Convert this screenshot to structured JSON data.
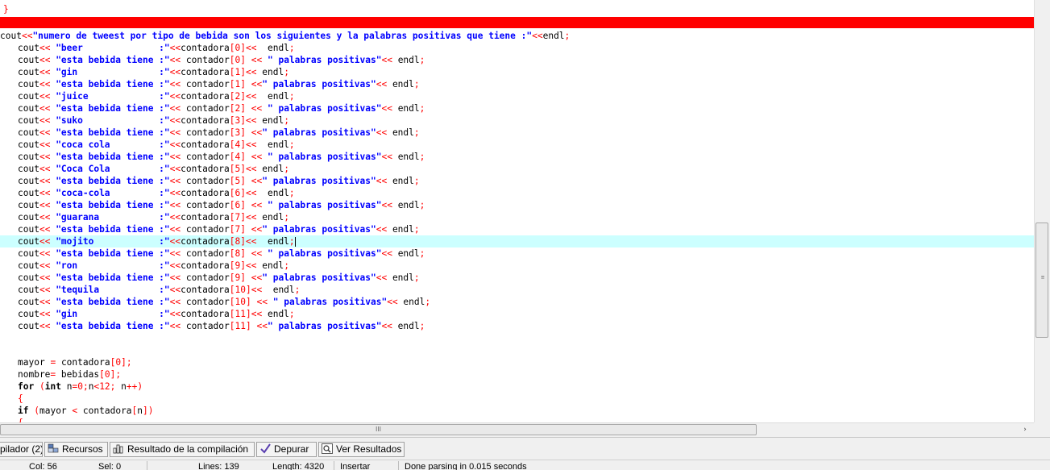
{
  "editor": {
    "code": {
      "l0": "}",
      "l2_1": "cout",
      "l2_2": "<<",
      "l2_3": "\"numero de tweest por tipo de bebida son los siguientes y la palabras positivas que tiene :\"",
      "l2_4": "<<",
      "l2_5": "endl",
      "l2_6": ";",
      "b_cout": "cout",
      "b_op": "<<",
      "b_endl": "endl",
      "b_semi": ";",
      "b_lb": "[",
      "b_rb": "]",
      "v_contadora": "contadora",
      "v_contador": "contador",
      "s_beer": "\"beer              :\"",
      "s_gin": "\"gin               :\"",
      "s_juice": "\"juice             :\"",
      "s_suko": "\"suko              :\"",
      "s_coca1": "\"coca cola         :\"",
      "s_coca2": "\"Coca Cola         :\"",
      "s_coca3": "\"coca-cola         :\"",
      "s_guarana": "\"guarana           :\"",
      "s_mojito": "\"mojito            :\"",
      "s_ron": "\"ron               :\"",
      "s_tequila": "\"tequila           :\"",
      "s_tiene": "\"esta bebida tiene :\"",
      "s_pal1": "\" palabras positivas\"",
      "s_pal2": "\" palabras positivas\"",
      "n0": "0",
      "n1": "1",
      "n2": "2",
      "n3": "3",
      "n4": "4",
      "n5": "5",
      "n6": "6",
      "n7": "7",
      "n8": "8",
      "n9": "9",
      "n10": "10",
      "n11": "11",
      "mayor": "mayor",
      "eq": "=",
      "nombre": "nombre",
      "bebidas": "bebidas",
      "for_kw": "for",
      "int_kw": "int",
      "if_kw": "if",
      "paren_o": "(",
      "paren_c": ")",
      "n_var": "n",
      "lt": "<",
      "n12": "12",
      "inc": "++",
      "brace_o": "{",
      "semi_sp": ";"
    }
  },
  "scrollbar": {
    "h_grip": "III",
    "h_right_arrow": "›"
  },
  "tabs": [
    {
      "label": "pilador (2)",
      "icon": "warning-list-icon"
    },
    {
      "label": "Recursos",
      "icon": "resources-icon"
    },
    {
      "label": "Resultado de la compilación",
      "icon": "chart-icon"
    },
    {
      "label": "Depurar",
      "icon": "checkmark-icon"
    },
    {
      "label": "Ver Resultados",
      "icon": "search-icon"
    }
  ],
  "statusbar": {
    "line": "Col: 56",
    "col": "Sel: 0",
    "lines": "Lines: 139",
    "length": "Length: 4320",
    "mode": "Insertar",
    "parse": "Done parsing in 0.015 seconds"
  },
  "colors": {
    "error_line": "#ff0000",
    "current_line": "#ccffff",
    "string": "#0000ff",
    "symbol": "#ff0000"
  }
}
